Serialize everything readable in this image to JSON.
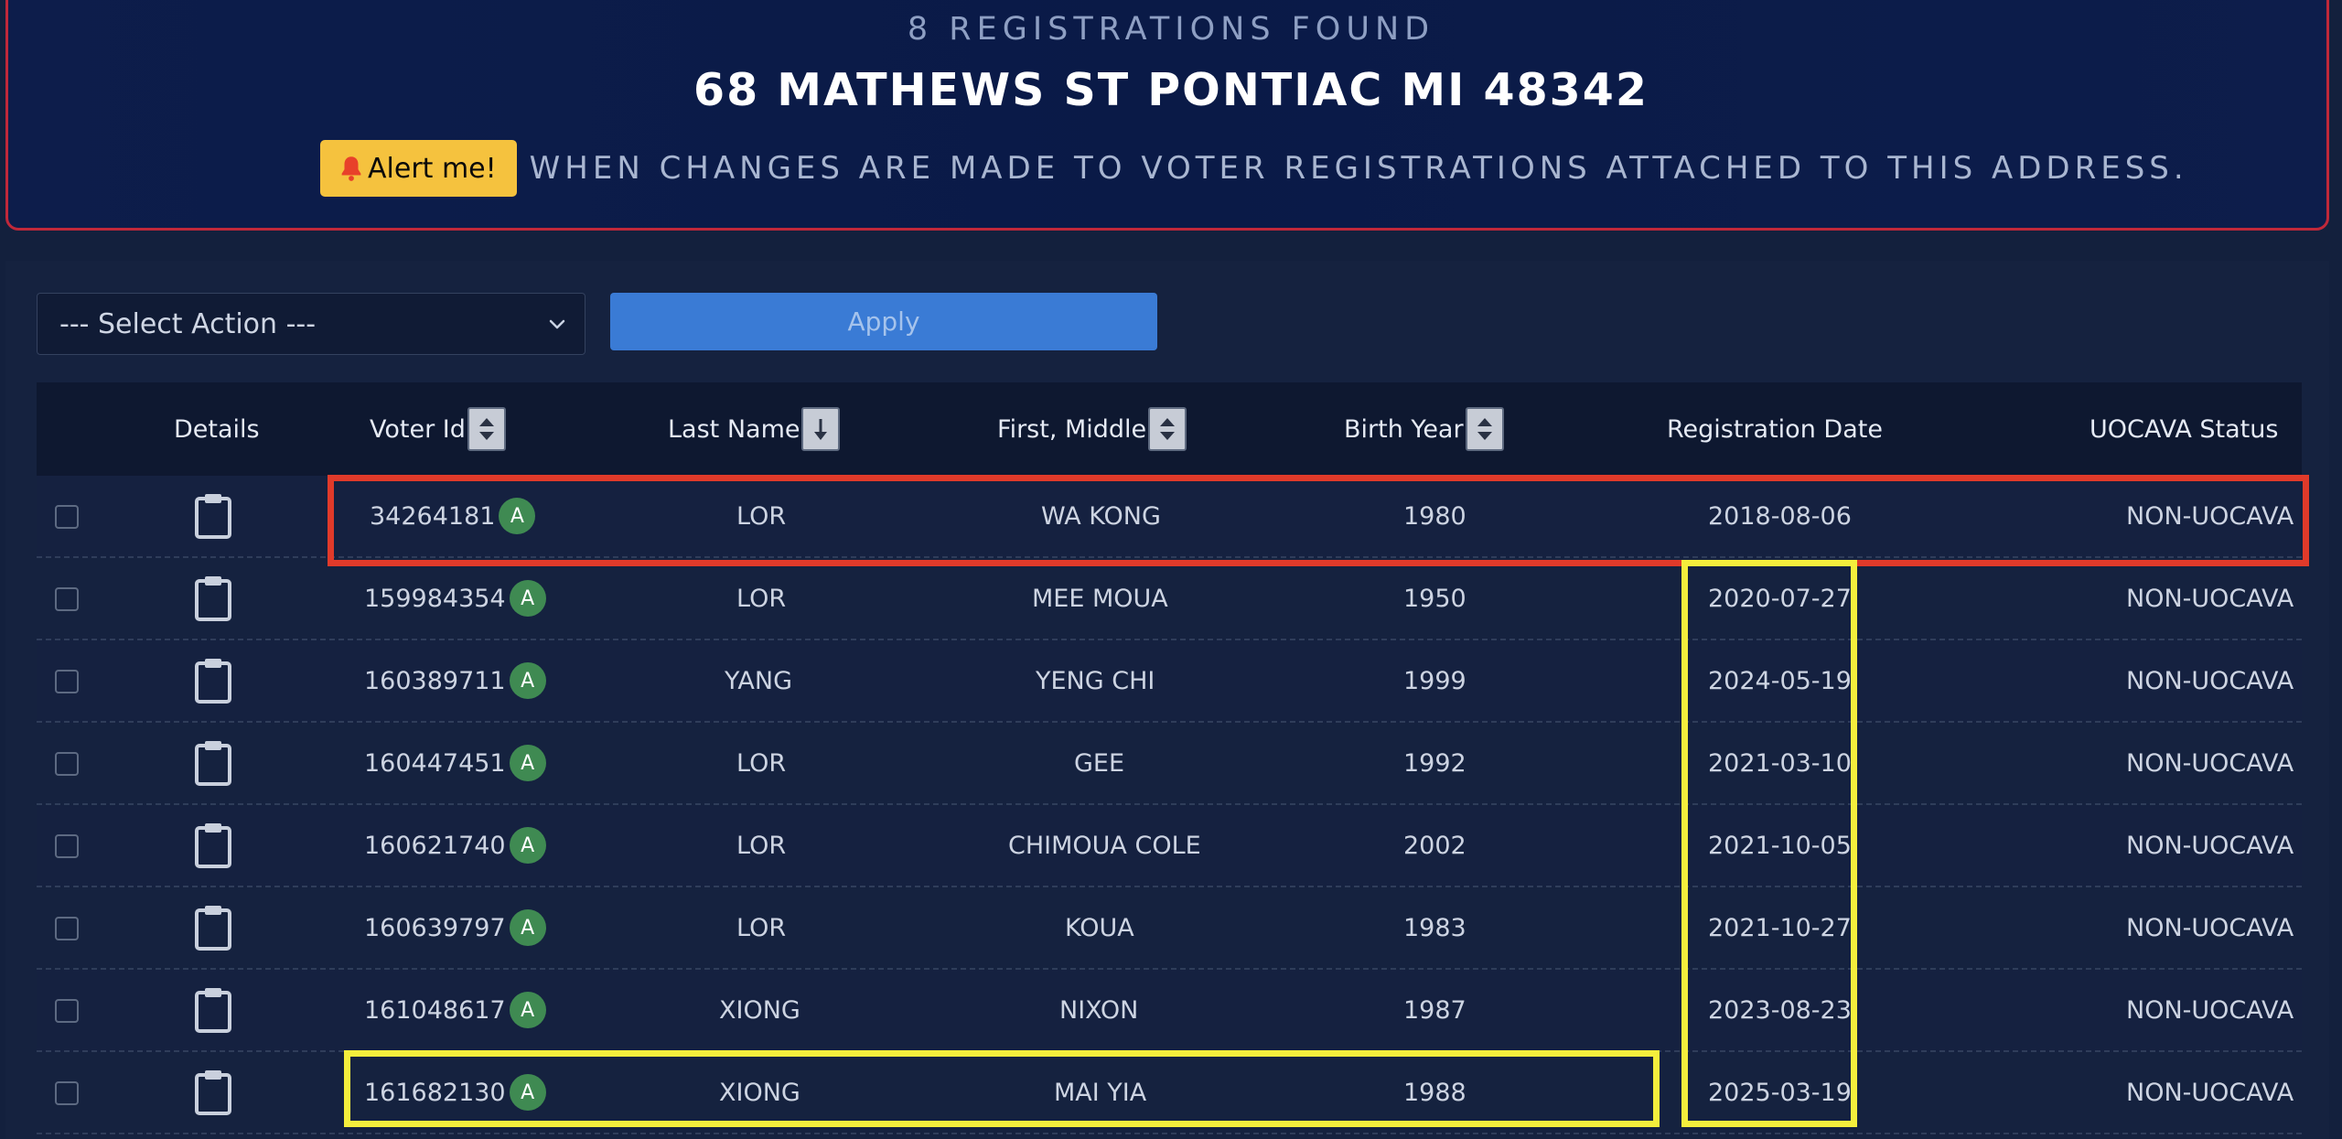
{
  "header": {
    "registrations_found": "8 REGISTRATIONS FOUND",
    "address": "68 MATHEWS ST PONTIAC MI 48342",
    "alert_button_label": "Alert me!",
    "alert_text": "WHEN CHANGES ARE MADE TO VOTER REGISTRATIONS ATTACHED TO THIS ADDRESS."
  },
  "toolbar": {
    "select_action_value": "--- Select Action ---",
    "apply_label": "Apply"
  },
  "table": {
    "columns": {
      "details": "Details",
      "voter_id": "Voter Id",
      "last_name": "Last Name",
      "first_middle": "First, Middle",
      "birth_year": "Birth Year",
      "registration_date": "Registration Date",
      "uocava_status": "UOCAVA Status"
    },
    "rows": [
      {
        "voter_id": "34264181",
        "badge": "A",
        "last_name": "LOR",
        "first_middle": "WA KONG",
        "birth_year": "1980",
        "registration_date": "2018-08-06",
        "uocava_status": "NON-UOCAVA"
      },
      {
        "voter_id": "159984354",
        "badge": "A",
        "last_name": "LOR",
        "first_middle": "MEE MOUA",
        "birth_year": "1950",
        "registration_date": "2020-07-27",
        "uocava_status": "NON-UOCAVA"
      },
      {
        "voter_id": "160389711",
        "badge": "A",
        "last_name": "YANG",
        "first_middle": "YENG CHI",
        "birth_year": "1999",
        "registration_date": "2024-05-19",
        "uocava_status": "NON-UOCAVA"
      },
      {
        "voter_id": "160447451",
        "badge": "A",
        "last_name": "LOR",
        "first_middle": "GEE",
        "birth_year": "1992",
        "registration_date": "2021-03-10",
        "uocava_status": "NON-UOCAVA"
      },
      {
        "voter_id": "160621740",
        "badge": "A",
        "last_name": "LOR",
        "first_middle": "CHIMOUA COLE",
        "birth_year": "2002",
        "registration_date": "2021-10-05",
        "uocava_status": "NON-UOCAVA"
      },
      {
        "voter_id": "160639797",
        "badge": "A",
        "last_name": "LOR",
        "first_middle": "KOUA",
        "birth_year": "1983",
        "registration_date": "2021-10-27",
        "uocava_status": "NON-UOCAVA"
      },
      {
        "voter_id": "161048617",
        "badge": "A",
        "last_name": "XIONG",
        "first_middle": "NIXON",
        "birth_year": "1987",
        "registration_date": "2023-08-23",
        "uocava_status": "NON-UOCAVA"
      },
      {
        "voter_id": "161682130",
        "badge": "A",
        "last_name": "XIONG",
        "first_middle": "MAI YIA",
        "birth_year": "1988",
        "registration_date": "2025-03-19",
        "uocava_status": "NON-UOCAVA"
      }
    ]
  },
  "colors": {
    "banner_border": "#c0283a",
    "alert_button": "#f5c23e",
    "apply_button": "#3a7bd5",
    "status_badge": "#3f8a52",
    "highlight_red": "#e03a2a",
    "highlight_yellow": "#f4ee3c"
  },
  "icons": {
    "alert": "bell-icon",
    "details": "clipboard-icon",
    "select": "chevron-down-icon",
    "sort_both": "sort-icon",
    "sort_desc": "sort-desc-icon"
  }
}
